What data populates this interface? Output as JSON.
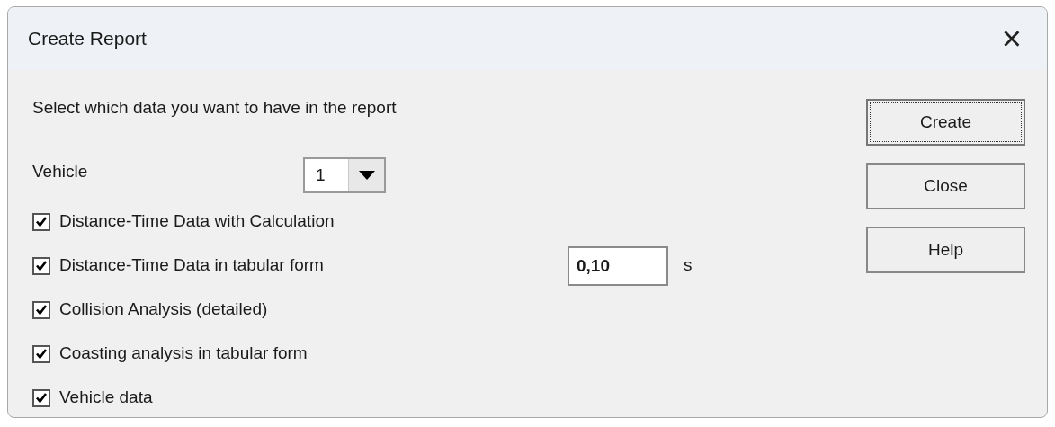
{
  "window": {
    "title": "Create Report",
    "close": "×"
  },
  "prompt": "Select which data you want to have in the report",
  "vehicle": {
    "label": "Vehicle",
    "value": "1"
  },
  "options": [
    {
      "label": "Distance-Time Data with Calculation",
      "checked": true
    },
    {
      "label": "Distance-Time Data in tabular form",
      "checked": true,
      "field": {
        "value": "0,10",
        "unit": "s"
      }
    },
    {
      "label": "Collision Analysis (detailed)",
      "checked": true
    },
    {
      "label": "Coasting analysis in tabular form",
      "checked": true
    },
    {
      "label": "Vehicle data",
      "checked": true
    }
  ],
  "buttons": [
    {
      "label": "Create",
      "focused": true
    },
    {
      "label": "Close",
      "focused": false
    },
    {
      "label": "Help",
      "focused": false
    }
  ]
}
